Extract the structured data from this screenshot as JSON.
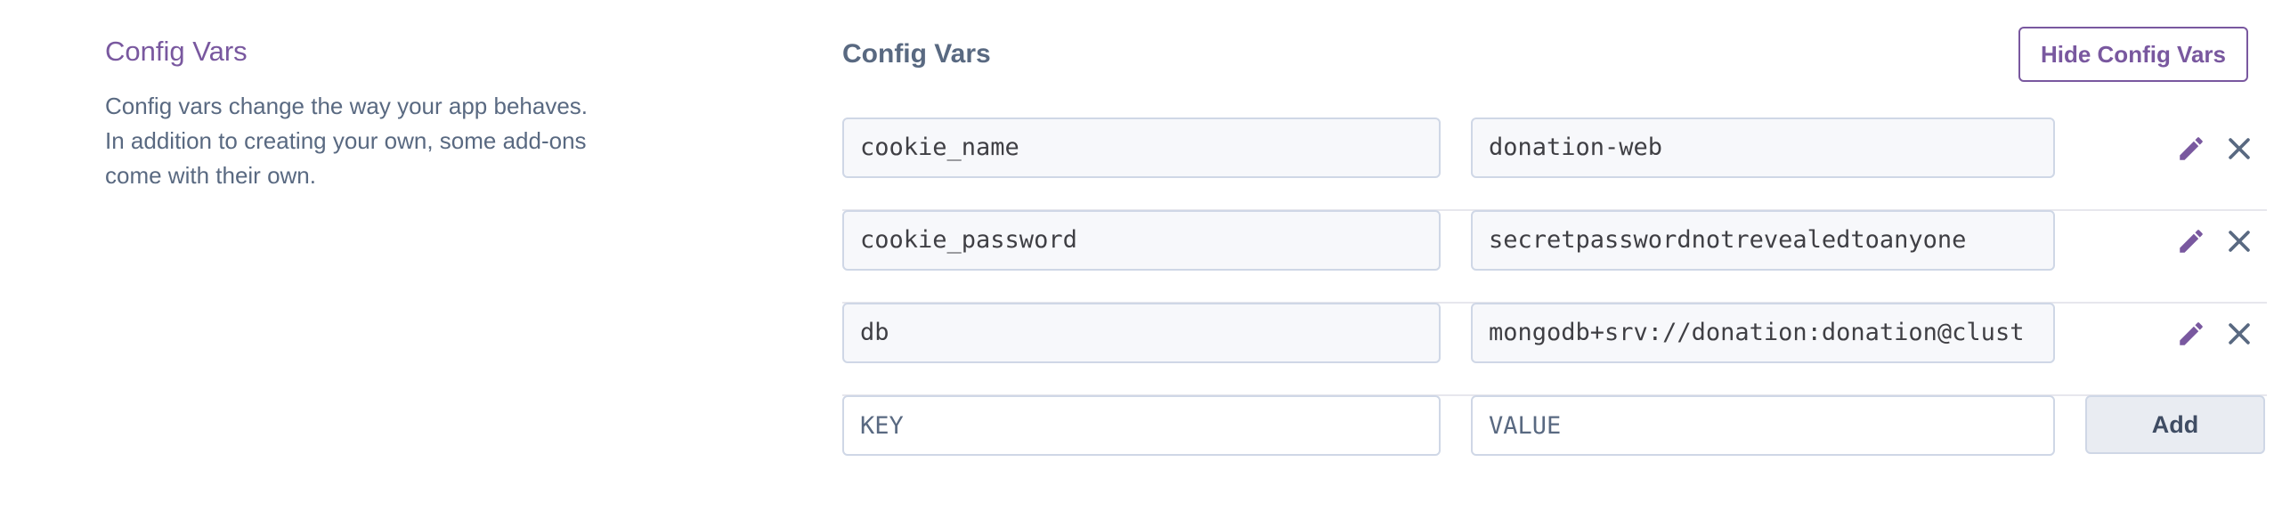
{
  "section": {
    "title": "Config Vars",
    "description": "Config vars change the way your app behaves. In addition to creating your own, some add-ons come with their own."
  },
  "panel": {
    "title": "Config Vars",
    "hide_button_label": "Hide Config Vars"
  },
  "config_vars": [
    {
      "key": "cookie_name",
      "value": "donation-web"
    },
    {
      "key": "cookie_password",
      "value": "secretpasswordnotrevealedtoanyone"
    },
    {
      "key": "db",
      "value": "mongodb+srv://donation:donation@clust"
    }
  ],
  "new_var": {
    "key_placeholder": "KEY",
    "value_placeholder": "VALUE",
    "add_label": "Add"
  },
  "colors": {
    "accent_purple": "#79589f",
    "text_slate": "#596981",
    "field_border": "#cfd7e6"
  },
  "icons": {
    "edit": "pencil-icon",
    "delete": "close-icon"
  }
}
